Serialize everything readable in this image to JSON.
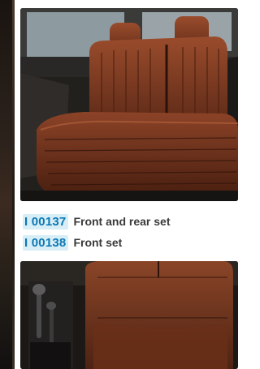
{
  "products": [
    {
      "code": "I 00137",
      "label": "Front and rear set"
    },
    {
      "code": "I 00138",
      "label": "Front set"
    }
  ],
  "colors": {
    "code_text": "#0a78b4",
    "code_badge_bg": "#d8eef7",
    "label_text": "#3a3a3a",
    "leather": "#7a3a22"
  },
  "images": [
    {
      "name": "rear-bench-leather-seat-photo",
      "subject": "rear bench seat with brown leather covers"
    },
    {
      "name": "front-seat-leather-photo",
      "subject": "front seat with brown leather cover beside gear lever"
    }
  ]
}
